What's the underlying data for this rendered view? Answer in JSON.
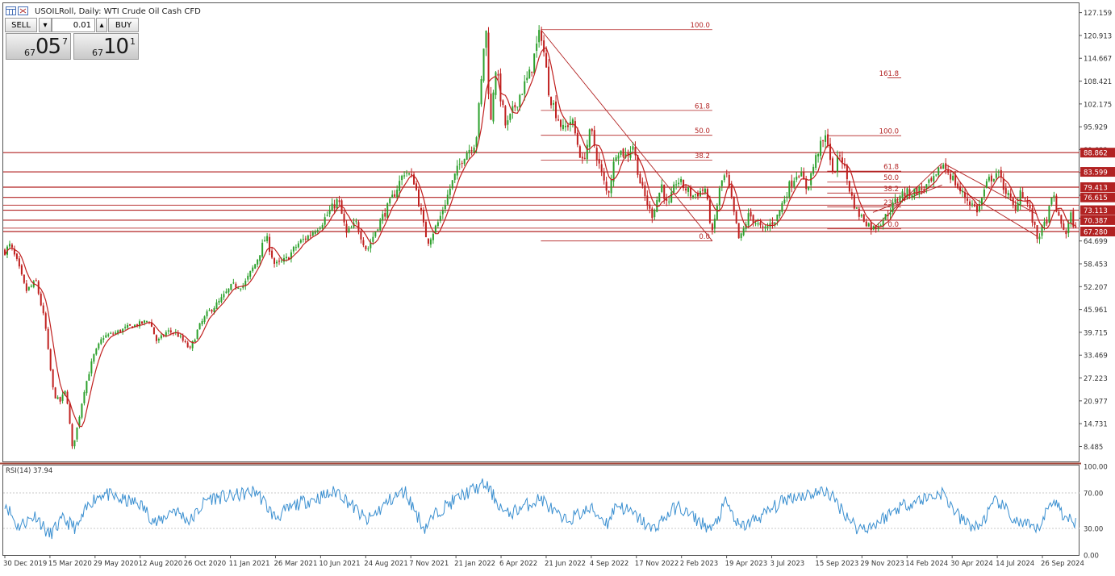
{
  "header": {
    "title": "USOILRoll, Daily:  WTI Crude Oil Cash CFD",
    "sell_label": "SELL",
    "buy_label": "BUY",
    "lot": "0.01",
    "sell_price_small": "67",
    "sell_price_big": "05",
    "sell_price_sup": "7",
    "buy_price_small": "67",
    "buy_price_big": "10",
    "buy_price_sup": "1"
  },
  "colors": {
    "bull": "#2ca02c",
    "bear": "#c0201f",
    "level": "#b22222",
    "rsi": "#3a8fd0",
    "grid_dotted": "#c8c8c8"
  },
  "chart_data": [
    {
      "type": "candlestick",
      "title": "USOILRoll, Daily:  WTI Crude Oil Cash CFD",
      "ylim": [
        4.4,
        129.5
      ],
      "y_ticks": [
        "127.159",
        "120.913",
        "114.667",
        "108.421",
        "102.175",
        "95.929",
        "89.683",
        "83.437",
        "77.191",
        "70.945",
        "64.699",
        "58.453",
        "52.207",
        "45.961",
        "39.715",
        "33.469",
        "27.223",
        "20.977",
        "14.731",
        "8.485"
      ],
      "x_tick_labels": [
        "30 Dec 2019",
        "15 Mar 2020",
        "29 May 2020",
        "12 Aug 2020",
        "26 Oct 2020",
        "11 Jan 2021",
        "26 Mar 2021",
        "10 Jun 2021",
        "24 Aug 2021",
        "7 Nov 2021",
        "21 Jan 2022",
        "6 Apr 2022",
        "21 Jun 2022",
        "4 Sep 2022",
        "17 Nov 2022",
        "2 Feb 2023",
        "19 Apr 2023",
        "3 Jul 2023",
        "15 Sep 2023",
        "29 Nov 2023",
        "14 Feb 2024",
        "30 Apr 2024",
        "14 Jul 2024",
        "26 Sep 2024"
      ],
      "price_path": [
        [
          "2019-12-30",
          62.0
        ],
        [
          "2020-01-08",
          63.5
        ],
        [
          "2020-01-20",
          58.5
        ],
        [
          "2020-02-03",
          51.0
        ],
        [
          "2020-02-20",
          53.5
        ],
        [
          "2020-03-06",
          42.0
        ],
        [
          "2020-03-12",
          33.0
        ],
        [
          "2020-03-20",
          23.0
        ],
        [
          "2020-03-30",
          20.5
        ],
        [
          "2020-04-10",
          24.0
        ],
        [
          "2020-04-20",
          8.0
        ],
        [
          "2020-04-28",
          13.5
        ],
        [
          "2020-05-10",
          24.0
        ],
        [
          "2020-05-25",
          33.0
        ],
        [
          "2020-06-10",
          38.5
        ],
        [
          "2020-06-30",
          39.5
        ],
        [
          "2020-07-20",
          41.0
        ],
        [
          "2020-08-10",
          42.0
        ],
        [
          "2020-08-26",
          43.0
        ],
        [
          "2020-09-08",
          37.0
        ],
        [
          "2020-09-25",
          40.0
        ],
        [
          "2020-10-10",
          39.5
        ],
        [
          "2020-11-02",
          35.0
        ],
        [
          "2020-11-16",
          41.0
        ],
        [
          "2020-12-01",
          45.0
        ],
        [
          "2020-12-20",
          48.0
        ],
        [
          "2021-01-11",
          52.5
        ],
        [
          "2021-01-30",
          52.5
        ],
        [
          "2021-02-20",
          59.0
        ],
        [
          "2021-03-08",
          66.0
        ],
        [
          "2021-03-23",
          58.0
        ],
        [
          "2021-04-10",
          59.5
        ],
        [
          "2021-05-01",
          64.0
        ],
        [
          "2021-05-17",
          66.0
        ],
        [
          "2021-06-10",
          70.0
        ],
        [
          "2021-07-06",
          76.0
        ],
        [
          "2021-07-20",
          66.5
        ],
        [
          "2021-08-05",
          69.5
        ],
        [
          "2021-08-23",
          62.0
        ],
        [
          "2021-09-10",
          69.0
        ],
        [
          "2021-09-30",
          75.0
        ],
        [
          "2021-10-25",
          84.0
        ],
        [
          "2021-11-10",
          81.0
        ],
        [
          "2021-11-26",
          68.0
        ],
        [
          "2021-12-02",
          64.5
        ],
        [
          "2021-12-20",
          70.0
        ],
        [
          "2022-01-10",
          80.0
        ],
        [
          "2022-01-30",
          88.0
        ],
        [
          "2022-02-20",
          92.0
        ],
        [
          "2022-03-02",
          110.0
        ],
        [
          "2022-03-08",
          125.5
        ],
        [
          "2022-03-16",
          95.0
        ],
        [
          "2022-03-24",
          113.0
        ],
        [
          "2022-04-11",
          95.5
        ],
        [
          "2022-05-02",
          104.0
        ],
        [
          "2022-05-20",
          110.0
        ],
        [
          "2022-06-08",
          122.5
        ],
        [
          "2022-06-22",
          105.0
        ],
        [
          "2022-07-05",
          99.0
        ],
        [
          "2022-07-15",
          95.0
        ],
        [
          "2022-07-29",
          98.0
        ],
        [
          "2022-08-16",
          86.0
        ],
        [
          "2022-08-30",
          95.0
        ],
        [
          "2022-09-12",
          86.0
        ],
        [
          "2022-09-27",
          77.0
        ],
        [
          "2022-10-12",
          90.0
        ],
        [
          "2022-10-28",
          88.0
        ],
        [
          "2022-11-08",
          91.0
        ],
        [
          "2022-11-21",
          80.0
        ],
        [
          "2022-12-09",
          71.5
        ],
        [
          "2022-12-26",
          80.0
        ],
        [
          "2023-01-05",
          73.5
        ],
        [
          "2023-01-20",
          81.5
        ],
        [
          "2023-02-15",
          77.0
        ],
        [
          "2023-03-08",
          79.0
        ],
        [
          "2023-03-20",
          66.5
        ],
        [
          "2023-04-03",
          80.5
        ],
        [
          "2023-04-12",
          83.0
        ],
        [
          "2023-05-04",
          64.5
        ],
        [
          "2023-05-20",
          72.0
        ],
        [
          "2023-06-12",
          67.5
        ],
        [
          "2023-07-05",
          71.0
        ],
        [
          "2023-07-25",
          79.5
        ],
        [
          "2023-08-10",
          84.0
        ],
        [
          "2023-08-24",
          79.0
        ],
        [
          "2023-09-12",
          89.5
        ],
        [
          "2023-09-27",
          93.5
        ],
        [
          "2023-10-06",
          82.5
        ],
        [
          "2023-10-19",
          89.0
        ],
        [
          "2023-11-06",
          77.0
        ],
        [
          "2023-11-16",
          72.5
        ],
        [
          "2023-12-12",
          68.0
        ],
        [
          "2024-01-03",
          71.5
        ],
        [
          "2024-01-26",
          77.5
        ],
        [
          "2024-02-15",
          78.0
        ],
        [
          "2024-03-05",
          79.0
        ],
        [
          "2024-03-25",
          81.5
        ],
        [
          "2024-04-05",
          86.0
        ],
        [
          "2024-04-22",
          82.0
        ],
        [
          "2024-05-06",
          78.0
        ],
        [
          "2024-06-03",
          73.0
        ],
        [
          "2024-06-20",
          81.0
        ],
        [
          "2024-07-05",
          83.5
        ],
        [
          "2024-07-24",
          77.0
        ],
        [
          "2024-08-05",
          72.5
        ],
        [
          "2024-08-12",
          79.0
        ],
        [
          "2024-08-26",
          74.5
        ],
        [
          "2024-09-10",
          65.5
        ],
        [
          "2024-09-25",
          70.0
        ],
        [
          "2024-10-07",
          77.5
        ],
        [
          "2024-10-16",
          70.5
        ],
        [
          "2024-10-28",
          67.0
        ],
        [
          "2024-11-05",
          71.5
        ],
        [
          "2024-11-14",
          67.1
        ]
      ],
      "horizontal_levels": [
        "88.862",
        "83.599",
        "79.413",
        "76.615",
        "73.113",
        "70.387",
        "67.280"
      ],
      "extra_levels": [
        74.5,
        68.2
      ],
      "fib_retracements": [
        {
          "x_start": "2022-06-08",
          "x_end": "2023-03-20",
          "high": 122.5,
          "low": 64.7,
          "levels": [
            {
              "label": "100.0",
              "value": 122.5
            },
            {
              "label": "61.8",
              "value": 100.4
            },
            {
              "label": "50.0",
              "value": 93.6
            },
            {
              "label": "38.2",
              "value": 86.8
            },
            {
              "label": "0.0",
              "value": 64.7
            }
          ]
        },
        {
          "x_start": "2023-09-27",
          "x_end": "2023-12-12",
          "high": 93.5,
          "low": 68.0,
          "levels": [
            {
              "label": "161.8",
              "value": 109.3
            },
            {
              "label": "100.0",
              "value": 93.5
            },
            {
              "label": "61.8",
              "value": 83.8
            },
            {
              "label": "50.0",
              "value": 80.8
            },
            {
              "label": "38.2",
              "value": 77.8
            },
            {
              "label": "23.6",
              "value": 74.0
            },
            {
              "label": "0.0",
              "value": 68.0
            }
          ]
        }
      ],
      "trendlines": [
        [
          [
            "2022-06-08",
            122.5
          ],
          [
            "2023-03-20",
            64.7
          ]
        ],
        [
          [
            "2023-12-12",
            68.0
          ],
          [
            "2024-04-05",
            86.0
          ]
        ],
        [
          [
            "2023-12-12",
            72.5
          ],
          [
            "2024-04-05",
            80.0
          ]
        ],
        [
          [
            "2024-04-12",
            85.5
          ],
          [
            "2024-09-10",
            72.0
          ]
        ],
        [
          [
            "2024-05-02",
            79.0
          ],
          [
            "2024-09-10",
            66.0
          ]
        ]
      ]
    },
    {
      "type": "line",
      "title": "RSI(14) 37.94",
      "ylim": [
        0,
        100
      ],
      "y_ticks": [
        "100.00",
        "70.00",
        "30.00",
        "0.00"
      ],
      "reference_lines": [
        70,
        30
      ],
      "rsi_path": [
        [
          "2019-12-30",
          60
        ],
        [
          "2020-01-20",
          32
        ],
        [
          "2020-02-20",
          45
        ],
        [
          "2020-03-12",
          22
        ],
        [
          "2020-04-05",
          40
        ],
        [
          "2020-04-28",
          30
        ],
        [
          "2020-05-20",
          60
        ],
        [
          "2020-06-10",
          70
        ],
        [
          "2020-07-10",
          62
        ],
        [
          "2020-08-10",
          58
        ],
        [
          "2020-09-08",
          35
        ],
        [
          "2020-10-05",
          52
        ],
        [
          "2020-11-02",
          38
        ],
        [
          "2020-12-01",
          64
        ],
        [
          "2021-01-11",
          66
        ],
        [
          "2021-02-20",
          72
        ],
        [
          "2021-03-23",
          42
        ],
        [
          "2021-05-01",
          58
        ],
        [
          "2021-06-10",
          66
        ],
        [
          "2021-07-06",
          72
        ],
        [
          "2021-08-23",
          38
        ],
        [
          "2021-09-30",
          62
        ],
        [
          "2021-10-25",
          72
        ],
        [
          "2021-11-26",
          30
        ],
        [
          "2021-12-20",
          50
        ],
        [
          "2022-01-30",
          68
        ],
        [
          "2022-03-08",
          80
        ],
        [
          "2022-04-11",
          45
        ],
        [
          "2022-06-08",
          64
        ],
        [
          "2022-07-15",
          38
        ],
        [
          "2022-08-30",
          52
        ],
        [
          "2022-09-27",
          36
        ],
        [
          "2022-10-12",
          58
        ],
        [
          "2022-11-21",
          40
        ],
        [
          "2022-12-09",
          28
        ],
        [
          "2023-01-20",
          55
        ],
        [
          "2023-03-20",
          28
        ],
        [
          "2023-04-12",
          60
        ],
        [
          "2023-05-04",
          30
        ],
        [
          "2023-06-12",
          45
        ],
        [
          "2023-07-25",
          65
        ],
        [
          "2023-09-27",
          72
        ],
        [
          "2023-11-16",
          30
        ],
        [
          "2023-12-12",
          33
        ],
        [
          "2024-01-26",
          55
        ],
        [
          "2024-04-05",
          70
        ],
        [
          "2024-05-06",
          40
        ],
        [
          "2024-06-03",
          30
        ],
        [
          "2024-07-05",
          62
        ],
        [
          "2024-08-05",
          38
        ],
        [
          "2024-09-10",
          28
        ],
        [
          "2024-10-07",
          64
        ],
        [
          "2024-10-28",
          40
        ],
        [
          "2024-11-14",
          37.94
        ]
      ]
    }
  ]
}
